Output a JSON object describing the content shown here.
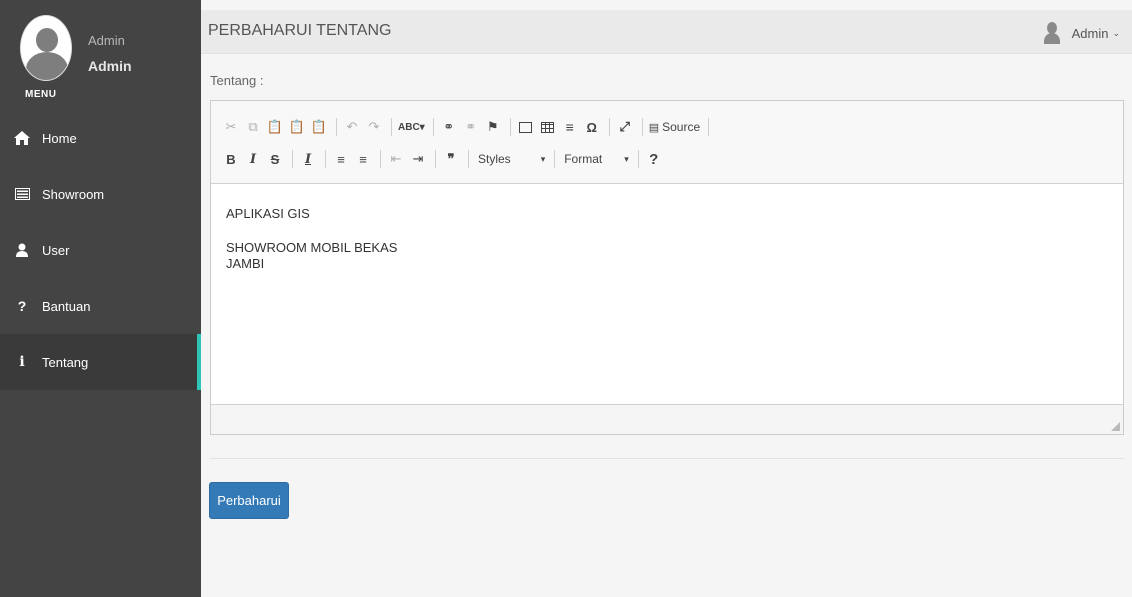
{
  "sidebar": {
    "profile": {
      "name_small": "Admin",
      "name_bold": "Admin"
    },
    "menu_label": "MENU",
    "items": [
      {
        "label": "Home",
        "icon": "home-icon"
      },
      {
        "label": "Showroom",
        "icon": "list-icon"
      },
      {
        "label": "User",
        "icon": "user-icon"
      },
      {
        "label": "Bantuan",
        "icon": "question-icon"
      },
      {
        "label": "Tentang",
        "icon": "info-icon",
        "active": true
      }
    ]
  },
  "header": {
    "title": "PERBAHARUI TENTANG",
    "user": "Admin"
  },
  "form": {
    "label": "Tentang :",
    "editor": {
      "toolbar": {
        "source_label": "Source",
        "styles_label": "Styles",
        "format_label": "Format"
      },
      "content": {
        "line1": "APLIKASI GIS",
        "line2": "SHOWROOM MOBIL BEKAS",
        "line3": "JAMBI"
      }
    },
    "submit_label": "Perbaharui"
  },
  "colors": {
    "sidebar_bg": "#444444",
    "active_accent": "#2ec4b6",
    "primary_button": "#337ab7"
  }
}
